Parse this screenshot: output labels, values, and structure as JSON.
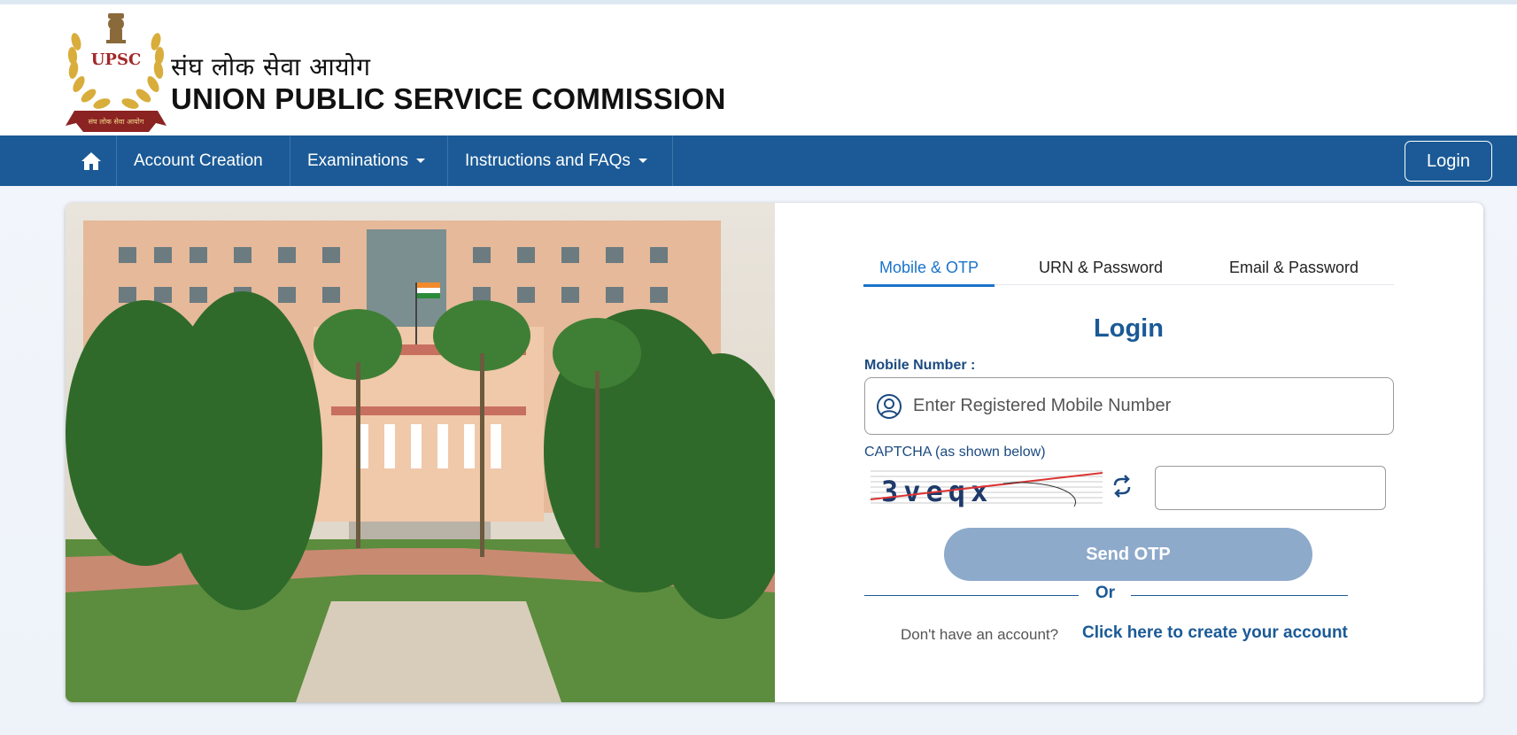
{
  "header": {
    "logo_text": "UPSC",
    "logo_ribbon_text": "संघ लोक सेवा आयोग",
    "title_hindi": "संघ लोक सेवा आयोग",
    "title_english": "UNION PUBLIC SERVICE COMMISSION"
  },
  "nav": {
    "home_icon": "home-icon",
    "items": [
      {
        "label": "Account Creation",
        "dropdown": false
      },
      {
        "label": "Examinations",
        "dropdown": true
      },
      {
        "label": "Instructions and FAQs",
        "dropdown": true
      }
    ],
    "login_label": "Login",
    "background": "#1b5a96"
  },
  "login": {
    "tabs": [
      {
        "label": "Mobile & OTP",
        "active": true
      },
      {
        "label": "URN & Password",
        "active": false
      },
      {
        "label": "Email & Password",
        "active": false
      }
    ],
    "title": "Login",
    "mobile_label": "Mobile Number :",
    "mobile_placeholder": "Enter Registered Mobile Number",
    "mobile_icon": "user-circle-icon",
    "captcha_label": "CAPTCHA (as shown below)",
    "captcha_text": "3veqx",
    "refresh_icon": "refresh-icon",
    "captcha_value": "",
    "send_otp_label": "Send OTP",
    "or_label": "Or",
    "signup_question": "Don't have an account?",
    "signup_link": "Click here to create your account"
  },
  "colors": {
    "primary": "#1b5a96",
    "tab_active": "#1a73c9",
    "button_disabled": "#8eaacb"
  }
}
